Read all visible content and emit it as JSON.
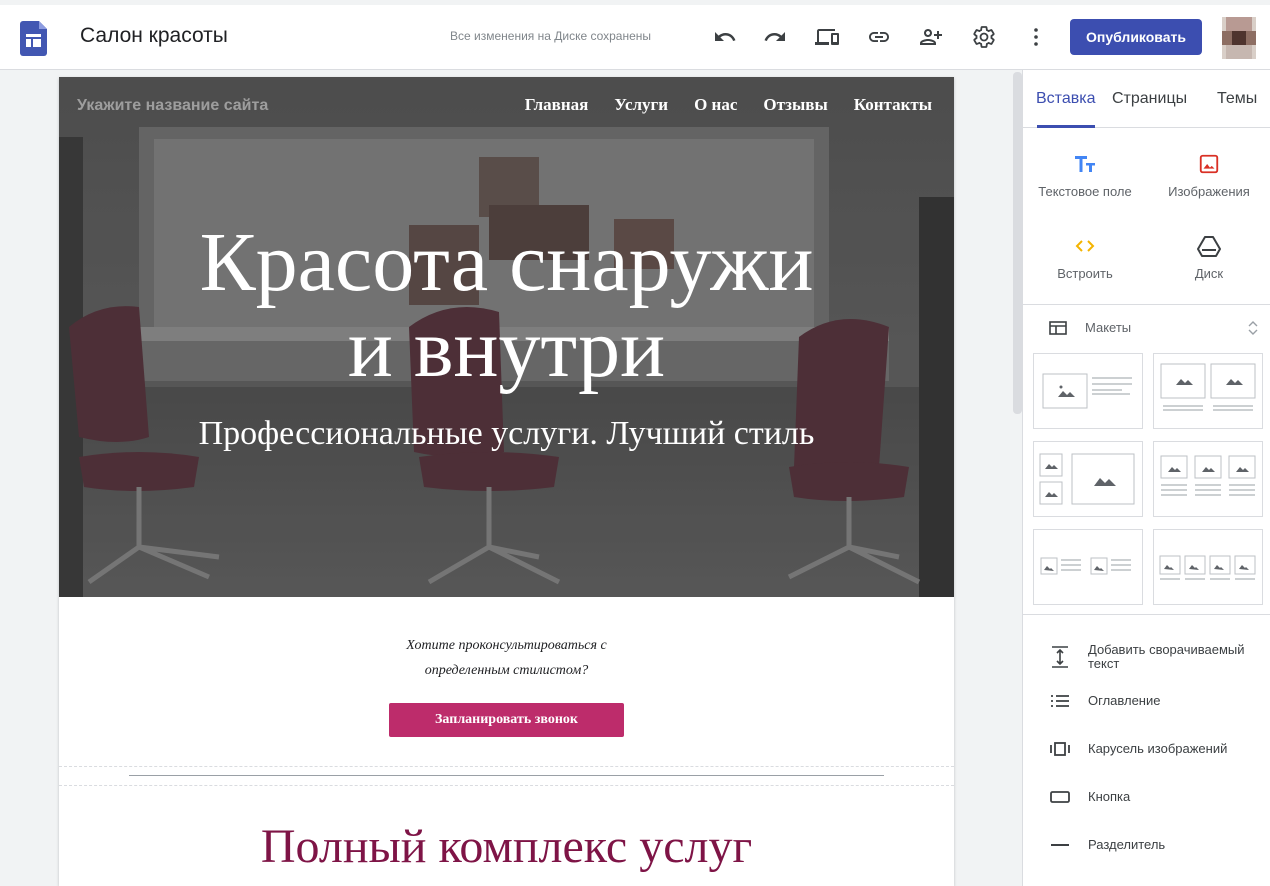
{
  "header": {
    "title": "Салон красоты",
    "save_status": "Все изменения на Диске сохранены",
    "publish_label": "Опубликовать",
    "icons": [
      "undo-icon",
      "redo-icon",
      "preview-devices-icon",
      "link-icon",
      "add-person-icon",
      "gear-icon",
      "more-vert-icon"
    ],
    "colors": {
      "accent": "#3c4eb0"
    }
  },
  "site": {
    "name_placeholder": "Укажите название сайта",
    "nav": [
      "Главная",
      "Услуги",
      "О нас",
      "Отзывы",
      "Контакты"
    ],
    "hero_line1": "Красота снаружи",
    "hero_line2": "и внутри",
    "hero_subtitle": "Профессиональные услуги. Лучший стиль",
    "consult_line1": "Хотите проконсультироваться с",
    "consult_line2": "определенным стилистом?",
    "cta_label": "Запланировать звонок",
    "section_title": "Полный комплекс услуг",
    "colors": {
      "cta": "#bd2c6b",
      "section_title": "#7e1446"
    }
  },
  "panel": {
    "tabs": [
      "Вставка",
      "Страницы",
      "Темы"
    ],
    "active_tab": "Вставка",
    "insert_items": [
      {
        "label": "Текстовое поле",
        "icon": "text-box-icon"
      },
      {
        "label": "Изображения",
        "icon": "image-icon"
      },
      {
        "label": "Встроить",
        "icon": "embed-icon"
      },
      {
        "label": "Диск",
        "icon": "drive-icon"
      }
    ],
    "layouts_label": "Макеты",
    "components": [
      {
        "label": "Добавить сворачиваемый текст",
        "icon": "collapsible-text-icon"
      },
      {
        "label": "Оглавление",
        "icon": "table-of-contents-icon"
      },
      {
        "label": "Карусель изображений",
        "icon": "carousel-icon"
      },
      {
        "label": "Кнопка",
        "icon": "button-icon"
      },
      {
        "label": "Разделитель",
        "icon": "divider-icon"
      }
    ]
  }
}
